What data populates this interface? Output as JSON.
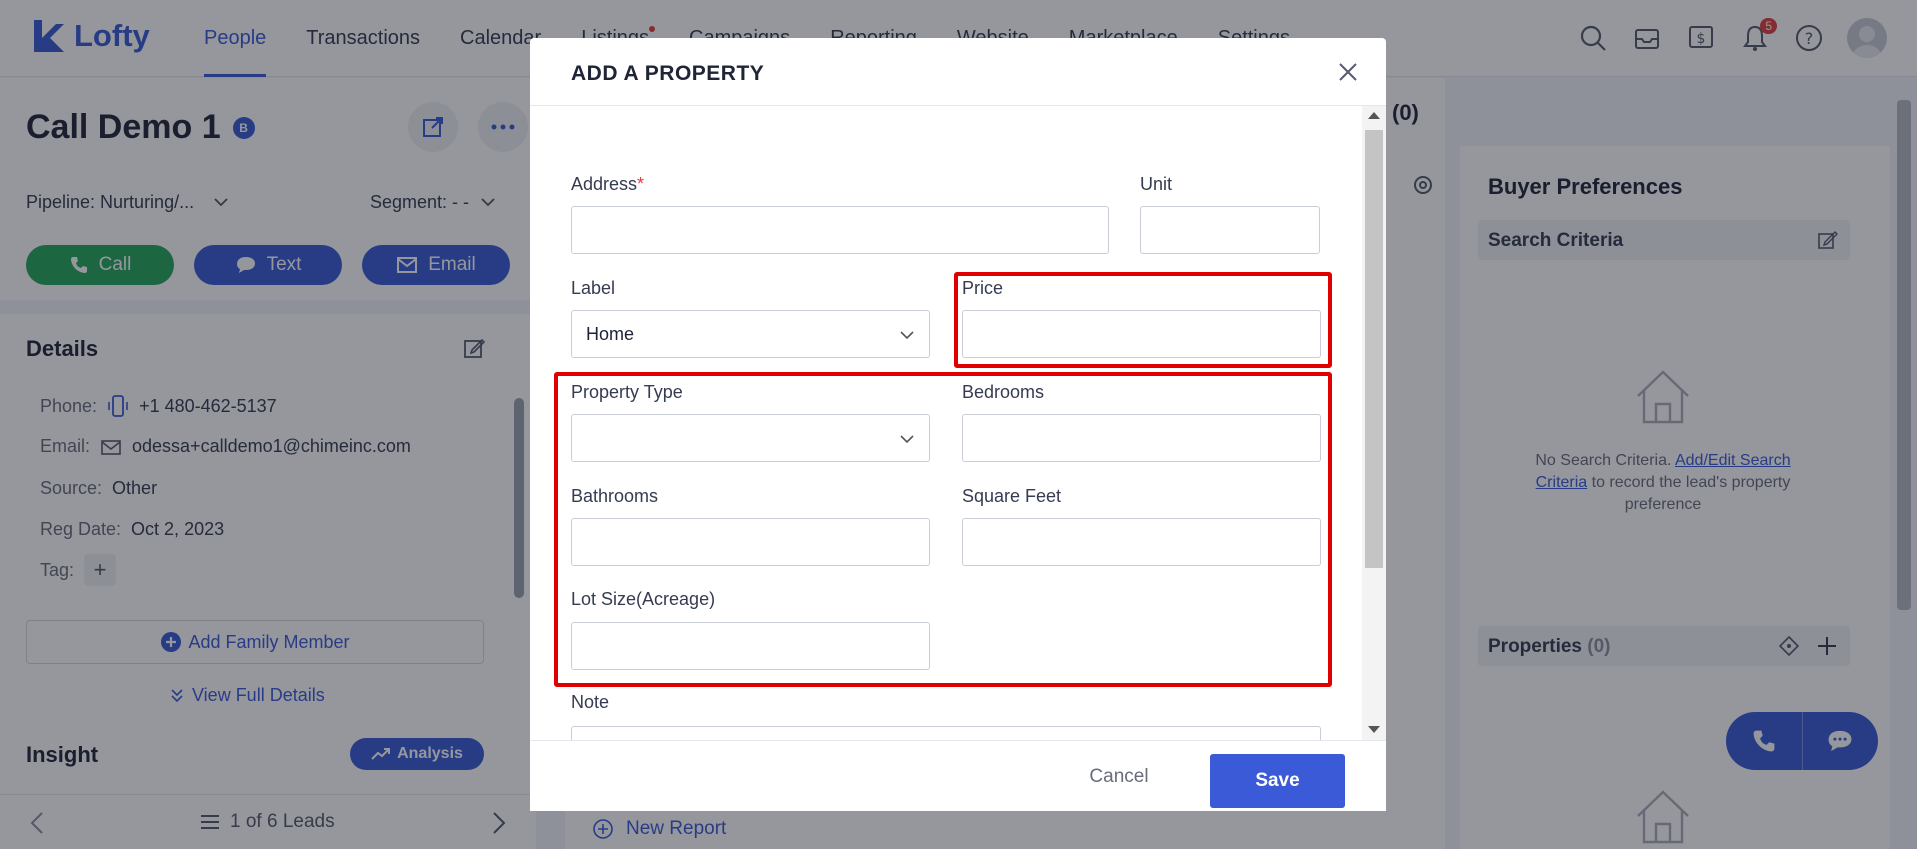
{
  "app": {
    "logo_text": "Lofty"
  },
  "nav": {
    "items": [
      "People",
      "Transactions",
      "Calendar",
      "Listings",
      "Campaigns",
      "Reporting",
      "Website",
      "Marketplace",
      "Settings"
    ],
    "notification_count": "5"
  },
  "lead": {
    "name": "Call Demo 1",
    "badge": "B",
    "pipeline": "Pipeline: Nurturing/...",
    "segment": "Segment: - -",
    "actions": {
      "call": "Call",
      "text": "Text",
      "email": "Email"
    }
  },
  "details": {
    "heading": "Details",
    "phone_label": "Phone:",
    "phone": "+1 480-462-5137",
    "email_label": "Email:",
    "email": "odessa+calldemo1@chimeinc.com",
    "source_label": "Source:",
    "source": "Other",
    "reg_label": "Reg Date:",
    "reg_date": "Oct 2, 2023",
    "tag_label": "Tag:",
    "add_family": "Add Family Member",
    "view_full": "View Full Details"
  },
  "insight": {
    "heading": "Insight",
    "analysis": "Analysis"
  },
  "pager": {
    "text": "1 of 6 Leads"
  },
  "middle": {
    "count": "(0)",
    "new_report": "New Report"
  },
  "buyer": {
    "heading": "Buyer Preferences",
    "search_criteria": "Search Criteria",
    "no_criteria_prefix": "No Search Criteria.",
    "no_criteria_link": "Add/Edit Search Criteria",
    "no_criteria_suffix": "to record the lead's property preference",
    "properties": "Properties",
    "properties_count": "(0)"
  },
  "modal": {
    "title": "ADD A PROPERTY",
    "address_label": "Address",
    "required_mark": "*",
    "unit_label": "Unit",
    "label_label": "Label",
    "label_value": "Home",
    "price_label": "Price",
    "property_type_label": "Property Type",
    "bedrooms_label": "Bedrooms",
    "bathrooms_label": "Bathrooms",
    "square_feet_label": "Square Feet",
    "lot_size_label": "Lot Size(Acreage)",
    "note_label": "Note",
    "cancel": "Cancel",
    "save": "Save"
  },
  "colors": {
    "accent": "#3a5ad8",
    "call_green": "#24a65a",
    "highlight": "#e00000"
  }
}
